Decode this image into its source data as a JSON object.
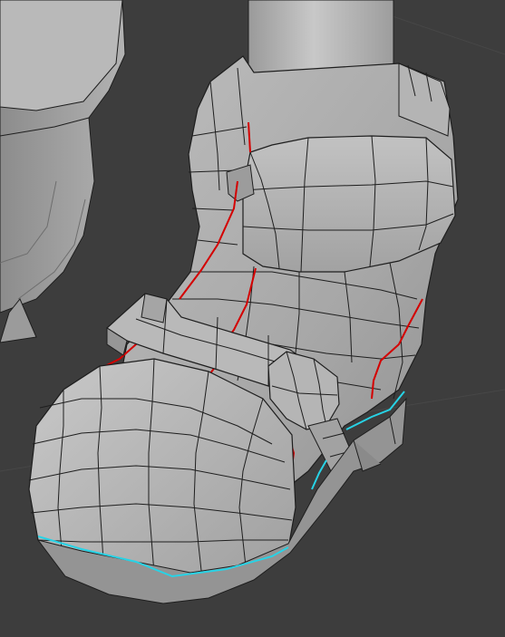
{
  "scene": {
    "background_color": "#3d3d3d",
    "mesh_fill_color": "#a9a9a9",
    "mesh_shade_color": "#8e8e8e",
    "mesh_highlight_color": "#c4c4c4",
    "wire_color": "#1e1e1e",
    "seam_color": "#d40000",
    "sharp_edge_color": "#27d3e6"
  },
  "icons": {
    "boot": "boot-mesh-icon",
    "leg": "leg-cylinder-icon",
    "cuff": "cuff-band-icon",
    "strap": "strap-band-icon",
    "buckle": "buckle-icon",
    "sole": "sole-icon"
  }
}
